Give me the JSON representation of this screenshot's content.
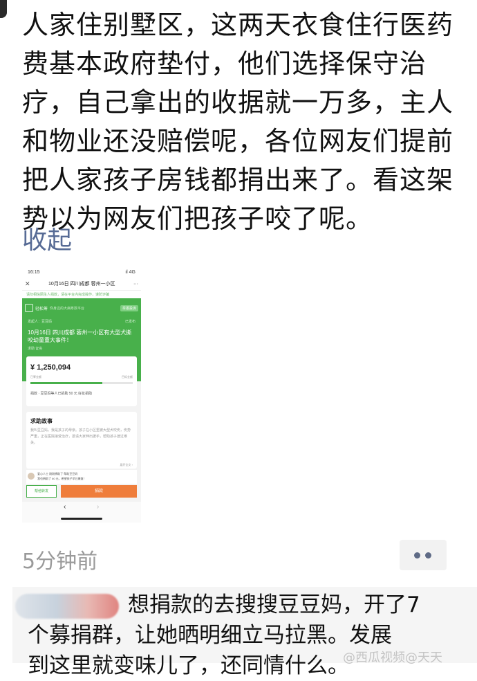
{
  "post": {
    "lines": [
      "人家住别墅区，这两天衣食住行医药",
      "费基本政府垫付，他们选择保守治",
      "疗，自己拿出的收据就一万多，主人",
      "和物业还没赔偿呢，各位网友们提前",
      "把人家孩子房钱都捐出来了。看这架",
      "势以为网友们把孩子咬了呢。"
    ],
    "collapse_label": "收起"
  },
  "screenshot": {
    "status_time": "16:15",
    "status_right": "ıl 4G",
    "nav_title": "10月16日 四川成都 蓉州一小区",
    "nav_more": "···",
    "notice": "请勿相信陌生人捐款，请在平台内完成操作，谨防诈骗",
    "brand": "轻松筹",
    "brand_sub": "你身边的大病筹款平台",
    "report_label": "举报投诉",
    "organizer": "发起人：豆豆妈",
    "published": "已发布",
    "headline": "10月16日 四川成都 蓉州一小区有大型犬撕咬幼童重大事件！",
    "tags": "求助  证实",
    "amount": "¥ 1,250,094",
    "raised_label": "已筹金额",
    "target_label": "目标金额",
    "progress": 0.7,
    "donors": "捐款 · 豆豆妈等人已捐助  50 元  好友捐助",
    "story_title": "求助故事",
    "story_body": "我叫豆豆妈，我是孩子的母亲。孩子在小区里被大型犬咬伤，伤势严重，正在医院接受治疗，恳请大家伸出援手，帮助孩子渡过难关。",
    "expand_label": "展开全文 ›",
    "comment_line1": "爱心人士 刚刚捐助了 帮助豆豆妈",
    "comment_line2": "我也捐助了 60 元，希望孩子早日康复！",
    "help_label": "帮他转发",
    "donate_label": "捐款",
    "back_symbol": "‹",
    "forward_symbol": "›"
  },
  "meta": {
    "time": "5分钟前"
  },
  "comment": {
    "lines": [
      "想捐款的去搜搜豆豆妈，开了7",
      "个募捐群，让她晒明细立马拉黑。发展",
      "到这里就变味儿了，还同情什么。"
    ],
    "watermark": "@西瓜视频@天天"
  }
}
